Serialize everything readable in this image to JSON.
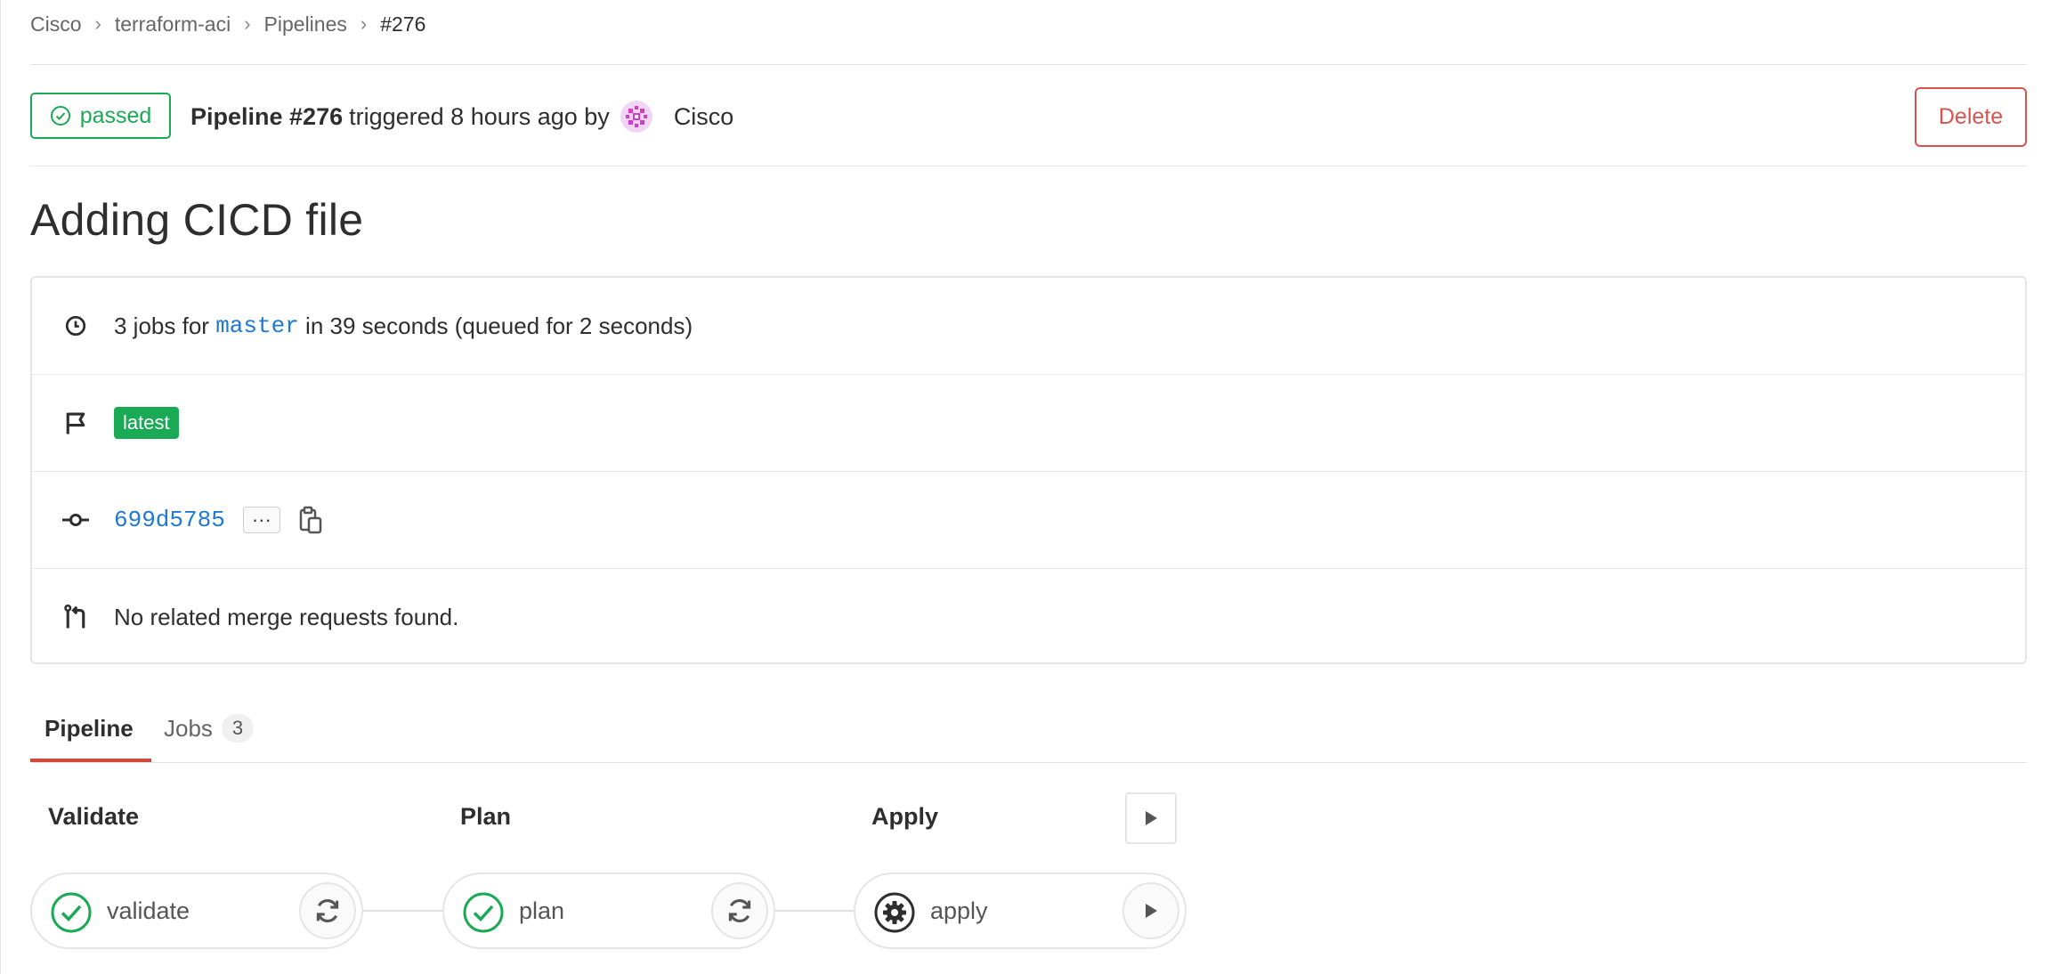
{
  "breadcrumb": {
    "items": [
      "Cisco",
      "terraform-aci",
      "Pipelines"
    ],
    "current": "#276",
    "separator": "›"
  },
  "header": {
    "status": "passed",
    "pipeline_label": "Pipeline #276",
    "triggered_text": "triggered 8 hours ago by",
    "user": "Cisco",
    "delete_label": "Delete"
  },
  "title": "Adding CICD file",
  "info": {
    "jobs_prefix": "3 jobs for",
    "branch": "master",
    "duration_text": "in 39 seconds (queued for 2 seconds)",
    "latest_badge": "latest",
    "commit_sha": "699d5785",
    "ellipsis": "···",
    "merge_requests": "No related merge requests found."
  },
  "tabs": {
    "pipeline": "Pipeline",
    "jobs": "Jobs",
    "jobs_count": "3"
  },
  "stages": [
    {
      "title": "Validate",
      "job": "validate",
      "status": "success",
      "action": "retry"
    },
    {
      "title": "Plan",
      "job": "plan",
      "status": "success",
      "action": "retry"
    },
    {
      "title": "Apply",
      "job": "apply",
      "status": "manual",
      "action": "play"
    }
  ],
  "colors": {
    "success": "#1aaa55",
    "danger": "#d9534f",
    "link": "#1f78d1",
    "active_tab": "#d24939"
  }
}
